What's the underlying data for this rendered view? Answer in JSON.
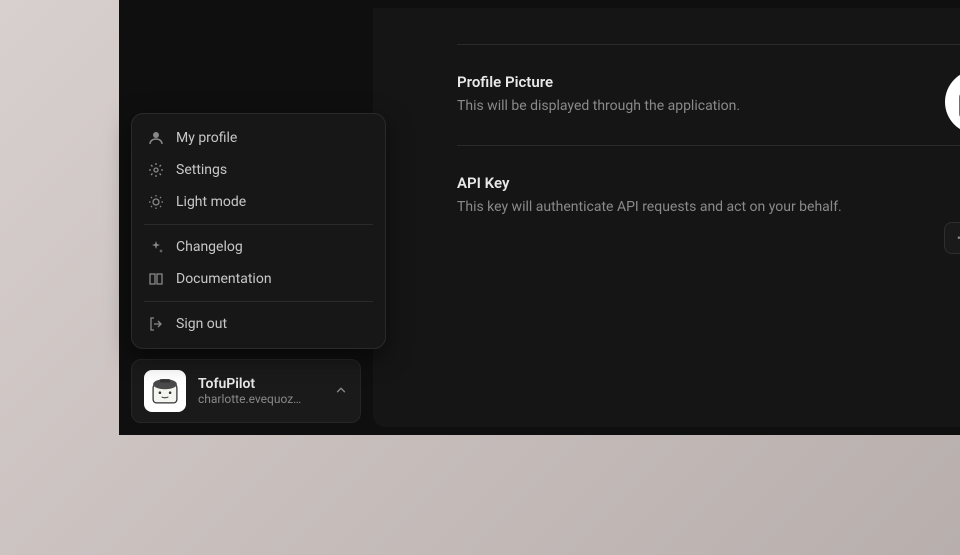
{
  "popup_menu": {
    "items": [
      {
        "label": "My profile",
        "icon": "user-icon"
      },
      {
        "label": "Settings",
        "icon": "gear-icon"
      },
      {
        "label": "Light mode",
        "icon": "sun-icon"
      }
    ],
    "items2": [
      {
        "label": "Changelog",
        "icon": "sparkle-icon"
      },
      {
        "label": "Documentation",
        "icon": "book-icon"
      }
    ],
    "items3": [
      {
        "label": "Sign out",
        "icon": "signout-icon"
      }
    ]
  },
  "user_card": {
    "name": "TofuPilot",
    "email": "charlotte.evequoz…"
  },
  "sections": {
    "profile_picture": {
      "title": "Profile Picture",
      "desc": "This will be displayed through the application."
    },
    "api_key": {
      "title": "API Key",
      "desc": "This key will authenticate API requests and act on your behalf.",
      "masked": "• • • •"
    }
  }
}
